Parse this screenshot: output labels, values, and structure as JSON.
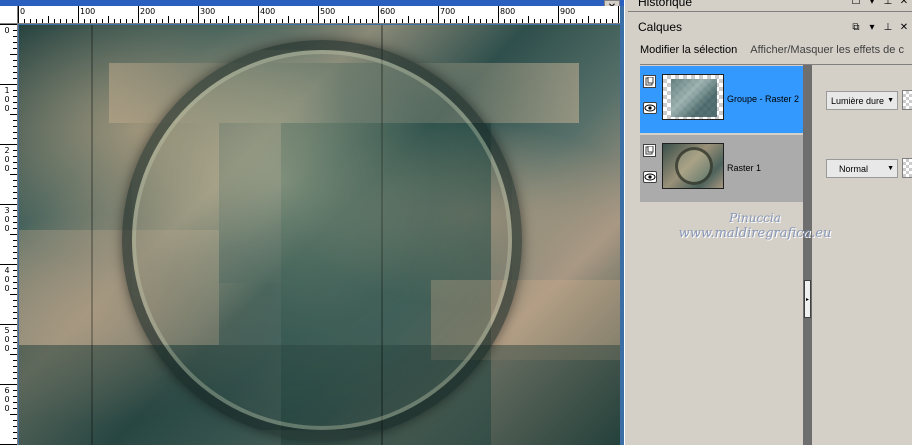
{
  "history_panel": {
    "title": "Historique"
  },
  "layers_panel": {
    "title": "Calques",
    "toolbar": {
      "modify_selection": "Modifier la sélection",
      "toggle_effects": "Afficher/Masquer les effets de c"
    },
    "layers": [
      {
        "name": "Groupe - Raster 2",
        "blend_mode": "Lumière dure",
        "selected": true
      },
      {
        "name": "Raster 1",
        "blend_mode": "Normal",
        "selected": false
      }
    ]
  },
  "ruler": {
    "h_labels": [
      "0",
      "100",
      "200",
      "300",
      "400",
      "500",
      "600",
      "700",
      "800",
      "900"
    ],
    "v_labels": [
      "0",
      "100",
      "200",
      "300",
      "400",
      "500",
      "600"
    ]
  },
  "watermark": {
    "line1": "Pinuccia",
    "line2": "www.maldiregrafica.eu"
  },
  "colors": {
    "selected_row": "#3399ff",
    "unselected_row": "#ababab",
    "panel_bg": "#d4d0c8",
    "title_bar": "#2a5fbf"
  },
  "icons": [
    "close-icon",
    "restore-icon",
    "dropdown-icon",
    "pin-icon",
    "layer-type-icon",
    "eye-icon",
    "collapse-arrow-icon"
  ]
}
